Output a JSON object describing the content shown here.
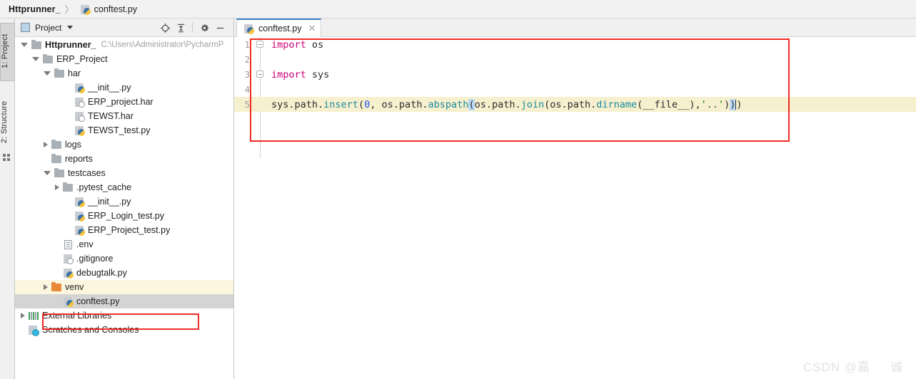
{
  "breadcrumb": {
    "root": "Httprunner_",
    "separator": "〉",
    "file": "conftest.py",
    "file_icon": "python-file-icon"
  },
  "tool_strip": {
    "project_tab": "1: Project",
    "structure_tab": "2: Structure"
  },
  "project_panel": {
    "title": "Project",
    "caret_icon": "chevron-down-icon",
    "toolbar_icons": [
      {
        "name": "locate-target-icon",
        "title": "Select Opened File"
      },
      {
        "name": "collapse-all-icon",
        "title": "Collapse All"
      },
      {
        "name": "gear-icon",
        "title": "Settings"
      },
      {
        "name": "minimize-icon",
        "title": "Hide"
      }
    ]
  },
  "tree": [
    {
      "label": "Httprunner_",
      "note": "C:\\Users\\Administrator\\PycharmP",
      "indent": 0,
      "arrow": "open",
      "icon": "folder-icon",
      "bold": true,
      "highlight": "none"
    },
    {
      "label": "ERP_Project",
      "note": "",
      "indent": 1,
      "arrow": "open",
      "icon": "folder-icon",
      "bold": false,
      "highlight": "none"
    },
    {
      "label": "har",
      "note": "",
      "indent": 2,
      "arrow": "open",
      "icon": "folder-icon",
      "bold": false,
      "highlight": "none"
    },
    {
      "label": "__init__.py",
      "note": "",
      "indent": 4,
      "arrow": "none",
      "icon": "python-file-icon",
      "bold": false,
      "highlight": "none"
    },
    {
      "label": "ERP_project.har",
      "note": "",
      "indent": 4,
      "arrow": "none",
      "icon": "har-file-icon",
      "bold": false,
      "highlight": "none"
    },
    {
      "label": "TEWST.har",
      "note": "",
      "indent": 4,
      "arrow": "none",
      "icon": "har-file-icon",
      "bold": false,
      "highlight": "none"
    },
    {
      "label": "TEWST_test.py",
      "note": "",
      "indent": 4,
      "arrow": "none",
      "icon": "python-file-icon",
      "bold": false,
      "highlight": "none"
    },
    {
      "label": "logs",
      "note": "",
      "indent": 2,
      "arrow": "closed",
      "icon": "folder-icon",
      "bold": false,
      "highlight": "none"
    },
    {
      "label": "reports",
      "note": "",
      "indent": 2,
      "arrow": "none",
      "icon": "folder-icon",
      "bold": false,
      "highlight": "none"
    },
    {
      "label": "testcases",
      "note": "",
      "indent": 2,
      "arrow": "open",
      "icon": "folder-icon",
      "bold": false,
      "highlight": "none"
    },
    {
      "label": ".pytest_cache",
      "note": "",
      "indent": 3,
      "arrow": "closed",
      "icon": "folder-icon",
      "bold": false,
      "highlight": "none"
    },
    {
      "label": "__init__.py",
      "note": "",
      "indent": 4,
      "arrow": "none",
      "icon": "python-file-icon",
      "bold": false,
      "highlight": "none"
    },
    {
      "label": "ERP_Login_test.py",
      "note": "",
      "indent": 4,
      "arrow": "none",
      "icon": "python-file-icon",
      "bold": false,
      "highlight": "none"
    },
    {
      "label": "ERP_Project_test.py",
      "note": "",
      "indent": 4,
      "arrow": "none",
      "icon": "python-file-icon",
      "bold": false,
      "highlight": "none"
    },
    {
      "label": ".env",
      "note": "",
      "indent": 3,
      "arrow": "none",
      "icon": "text-file-icon",
      "bold": false,
      "highlight": "none"
    },
    {
      "label": ".gitignore",
      "note": "",
      "indent": 3,
      "arrow": "none",
      "icon": "gitignore-file-icon",
      "bold": false,
      "highlight": "none"
    },
    {
      "label": "debugtalk.py",
      "note": "",
      "indent": 3,
      "arrow": "none",
      "icon": "python-file-icon",
      "bold": false,
      "highlight": "none"
    },
    {
      "label": "venv",
      "note": "",
      "indent": 2,
      "arrow": "closed",
      "icon": "folder-orange-icon",
      "bold": false,
      "highlight": "yellow"
    },
    {
      "label": "conftest.py",
      "note": "",
      "indent": 3,
      "arrow": "none",
      "icon": "python-file-icon",
      "bold": false,
      "highlight": "gray"
    },
    {
      "label": "External Libraries",
      "note": "",
      "indent": 0,
      "arrow": "closed",
      "icon": "external-libraries-icon",
      "bold": false,
      "highlight": "none"
    },
    {
      "label": "Scratches and Consoles",
      "note": "",
      "indent": 0,
      "arrow": "none",
      "icon": "scratches-icon",
      "bold": false,
      "highlight": "none"
    }
  ],
  "editor": {
    "tab_label": "conftest.py",
    "tab_icon": "python-file-icon",
    "tab_close": "✕",
    "lines": [
      {
        "number": "1",
        "fold": true
      },
      {
        "number": "2",
        "fold": false
      },
      {
        "number": "3",
        "fold": true
      },
      {
        "number": "4",
        "fold": false
      },
      {
        "number": "5",
        "fold": false,
        "current": true
      }
    ],
    "code": {
      "line1_kw": "import",
      "line1_mod": " os",
      "line3_kw": "import",
      "line3_mod": " sys",
      "line5_full": "sys.path.insert(0, os.path.abspath(os.path.join(os.path.dirname(__file__),'..')))",
      "l5_a": "sys",
      "l5_b": ".path.",
      "l5_c": "insert",
      "l5_d": "(",
      "l5_e": "0",
      "l5_f": ", os.path.",
      "l5_g": "abspath",
      "l5_h": "(",
      "l5_i": "os.path.",
      "l5_j": "join",
      "l5_k": "(os.path.",
      "l5_l": "dirname",
      "l5_m": "(__file__),",
      "l5_n": "'..'",
      "l5_o": ")",
      "l5_p": ")",
      "l5_q": ")"
    }
  },
  "annotations": {
    "box_color": "#ef2b24",
    "conftest_box": "red-highlight-box-conftest",
    "code_box": "red-highlight-box-code"
  },
  "watermark": {
    "text_left": "CSDN @嘉",
    "text_right": "诚"
  },
  "colors": {
    "tab_active_top": "#3c80c8",
    "current_line": "#f7f0cf",
    "selection_gray": "#d4d4d4",
    "venv_highlight": "#fbf6dd"
  }
}
